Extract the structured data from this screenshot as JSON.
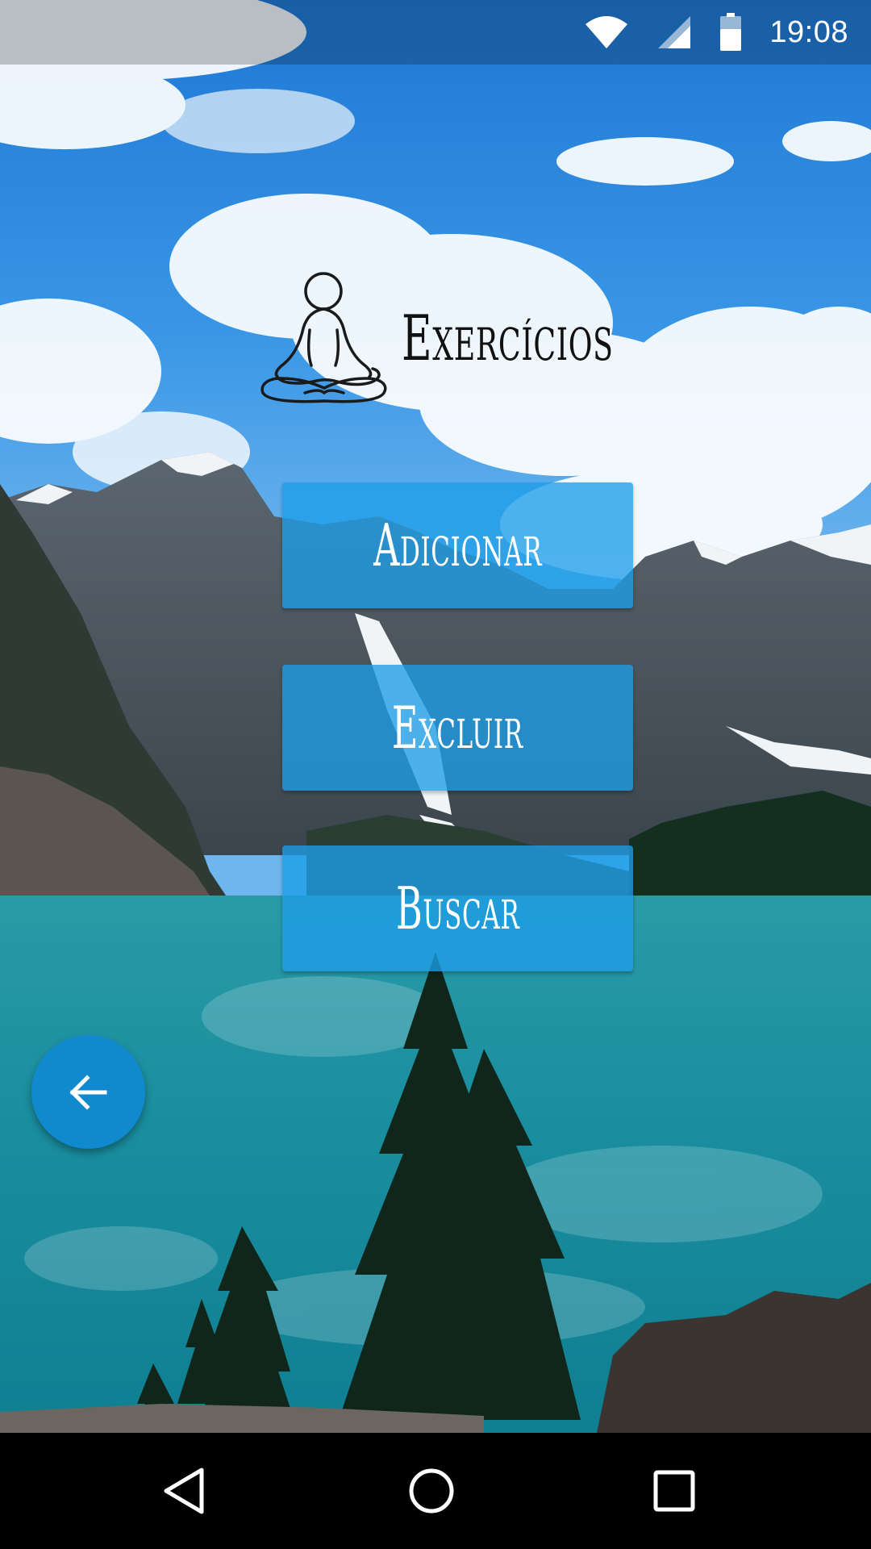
{
  "status_bar": {
    "time": "19:08",
    "icons": [
      "wifi-icon",
      "signal-icon",
      "battery-icon"
    ]
  },
  "header": {
    "title": "Exercícios",
    "icon": "meditation-icon"
  },
  "buttons": {
    "add_label": "Adicionar",
    "delete_label": "Excluir",
    "search_label": "Buscar"
  },
  "fab": {
    "icon": "arrow-back-icon"
  },
  "nav_bar": {
    "icons": [
      "nav-back-icon",
      "nav-home-icon",
      "nav-recents-icon"
    ]
  },
  "colors": {
    "button_bg": "#1e9ee8",
    "fab_bg": "#1189cf",
    "text_light": "#ffffff",
    "title_text": "#111111"
  }
}
